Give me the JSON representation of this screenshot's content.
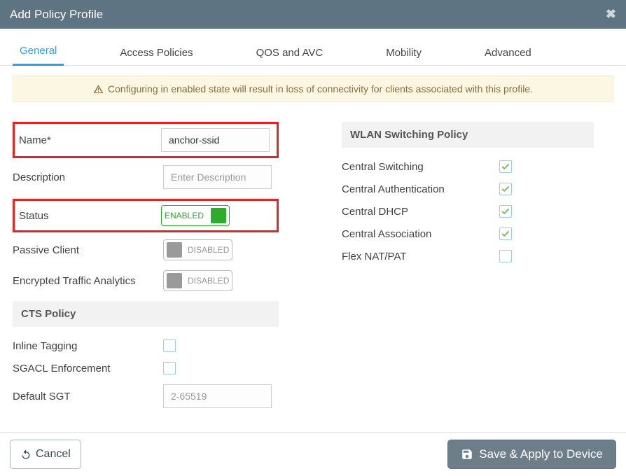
{
  "title": "Add Policy Profile",
  "tabs": {
    "general": "General",
    "access": "Access Policies",
    "qos": "QOS and AVC",
    "mobility": "Mobility",
    "advanced": "Advanced"
  },
  "alert": "Configuring in enabled state will result in loss of connectivity for clients associated with this profile.",
  "left": {
    "name_label": "Name*",
    "name_value": "anchor-ssid",
    "description_label": "Description",
    "description_placeholder": "Enter Description",
    "status_label": "Status",
    "status_toggle": "ENABLED",
    "passive_client_label": "Passive Client",
    "passive_client_toggle": "DISABLED",
    "enc_traffic_label": "Encrypted Traffic Analytics",
    "enc_traffic_toggle": "DISABLED",
    "cts_header": "CTS Policy",
    "inline_tagging_label": "Inline Tagging",
    "sgacl_label": "SGACL Enforcement",
    "default_sgt_label": "Default SGT",
    "default_sgt_placeholder": "2-65519"
  },
  "right": {
    "wlan_header": "WLAN Switching Policy",
    "central_switching_label": "Central Switching",
    "central_auth_label": "Central Authentication",
    "central_dhcp_label": "Central DHCP",
    "central_assoc_label": "Central Association",
    "flex_nat_label": "Flex NAT/PAT"
  },
  "footer": {
    "cancel": "Cancel",
    "save": "Save & Apply to Device"
  }
}
